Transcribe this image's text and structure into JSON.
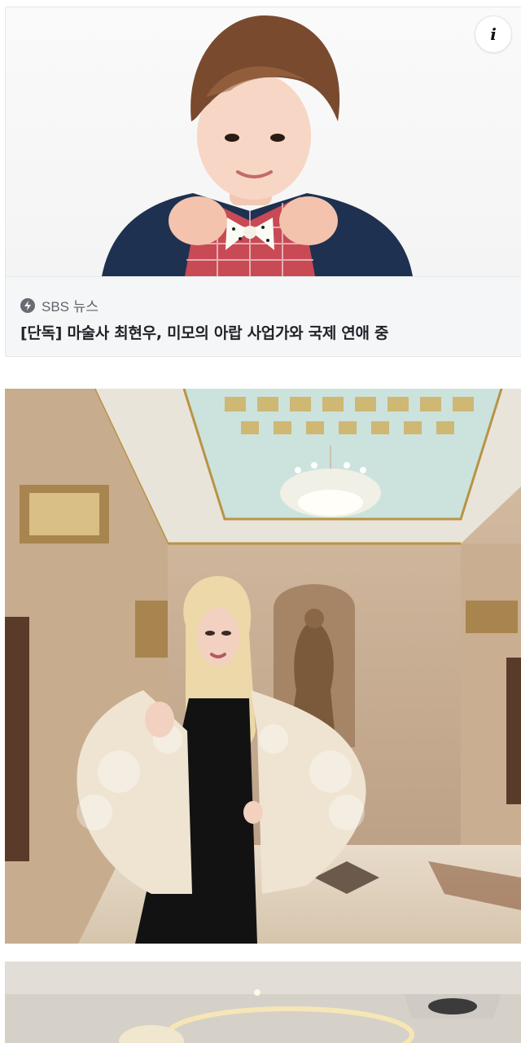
{
  "card": {
    "info_icon": "info-icon",
    "source": {
      "icon": "bolt-icon",
      "name": "SBS 뉴스"
    },
    "headline": "[단독] 마술사 최현우, 미모의 아랍 사업가와 국제 연애 중"
  },
  "colors": {
    "card_background": "#f5f6f8",
    "source_text": "#5f646b",
    "headline_text": "#1f2328"
  }
}
